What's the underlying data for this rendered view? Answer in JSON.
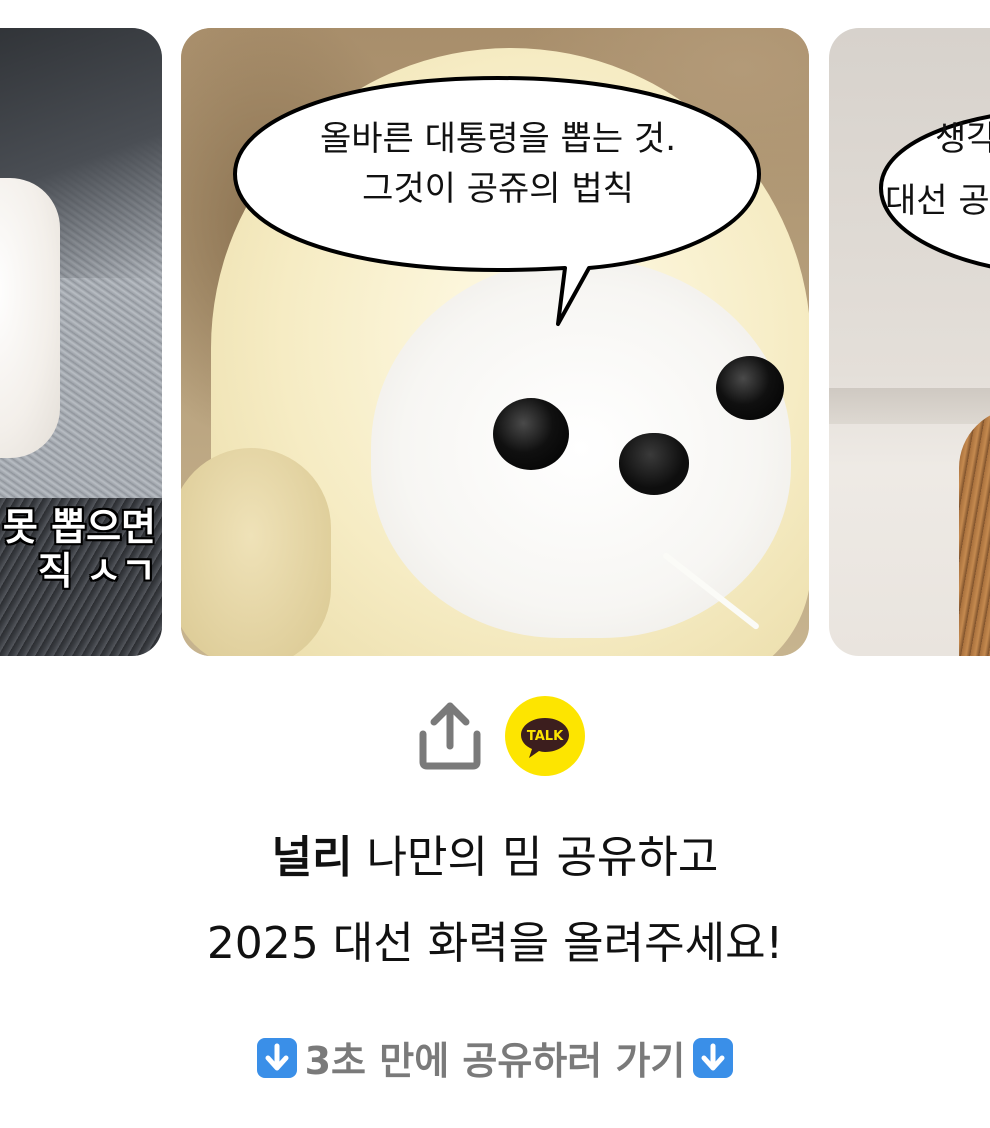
{
  "carousel": {
    "left_card": {
      "caption_line1": "못 뽑으면",
      "caption_line2": "직 ㅅㄱ"
    },
    "center_card": {
      "bubble_line1": "올바른 대통령을 뽑는 것.",
      "bubble_line2": "그것이 공쥬의 법칙"
    },
    "right_card": {
      "bubble_line1": "생각",
      "bubble_line2": "대선 공"
    }
  },
  "share": {
    "share_icon": "share-upload-icon",
    "kakao_label": "TALK",
    "kakao_color": "#FDE500"
  },
  "headline": {
    "brand": "널리",
    "line1_rest": " 나만의 밈 공유하고",
    "line2": "2025 대선 화력을 올려주세요!"
  },
  "cta": {
    "label": "3초 만에 공유하러 가기",
    "icon": "down-arrow-emoji-icon"
  },
  "colors": {
    "text": "#111111",
    "cta_text": "#7A7A7A",
    "icon_gray": "#7A7A7A"
  }
}
